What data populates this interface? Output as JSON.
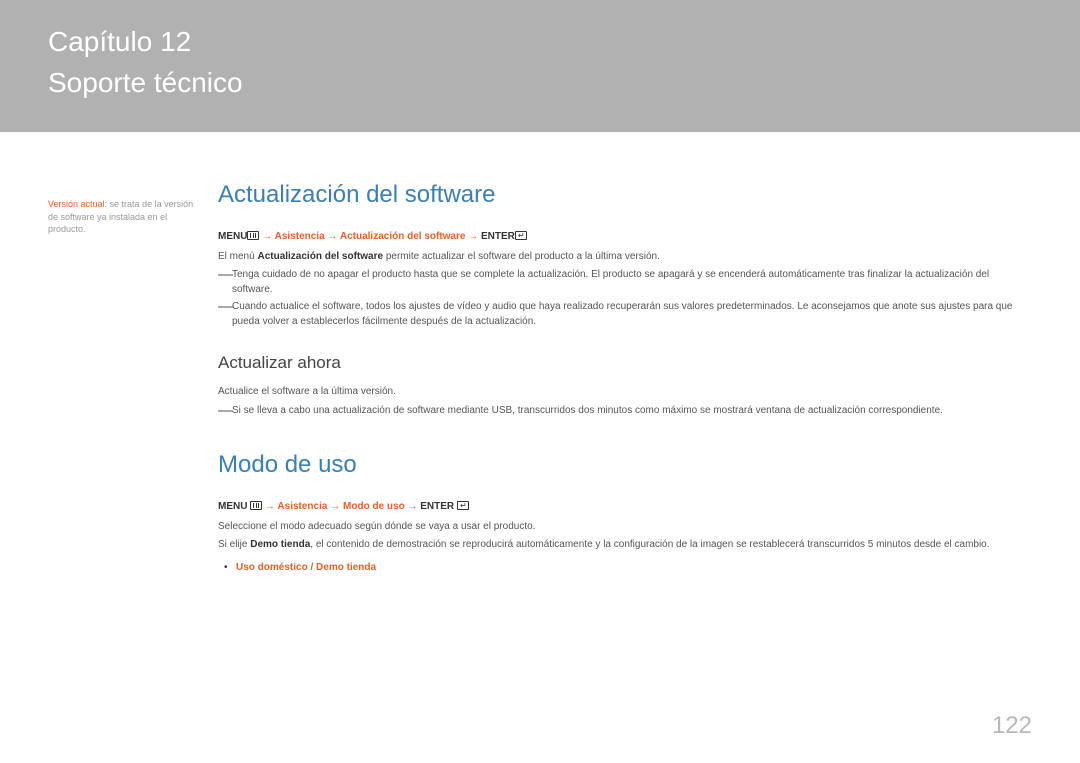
{
  "header": {
    "chapter_number": "Capítulo 12",
    "chapter_title": "Soporte técnico"
  },
  "sidebar": {
    "version_label": "Versión actual",
    "version_desc": ": se trata de la versión de software ya instalada en el producto."
  },
  "section1": {
    "title": "Actualización del software",
    "nav": {
      "menu": "MENU",
      "arrow": " → ",
      "p1": "Asistencia",
      "p2": "Actualización del software",
      "enter": "ENTER"
    },
    "intro_pre": "El menú ",
    "intro_bold": "Actualización del software",
    "intro_post": " permite actualizar el software del producto a la última versión.",
    "dash1": "Tenga cuidado de no apagar el producto hasta que se complete la actualización. El producto se apagará y se encenderá automáticamente tras finalizar la actualización del software.",
    "dash2": "Cuando actualice el software, todos los ajustes de vídeo y audio que haya realizado recuperarán sus valores predeterminados. Le aconsejamos que anote sus ajustes para que pueda volver a establecerlos fácilmente después de la actualización.",
    "sub1": {
      "title": "Actualizar ahora",
      "p1": "Actualice el software a la última versión.",
      "dash1": "Si se lleva a cabo una actualización de software mediante USB, transcurridos dos minutos como máximo se mostrará ventana de actualización correspondiente."
    }
  },
  "section2": {
    "title": "Modo de uso",
    "nav": {
      "menu": "MENU",
      "arrow": " → ",
      "p1": "Asistencia",
      "p2": "Modo de uso",
      "enter": "ENTER"
    },
    "p1": "Seleccione el modo adecuado según dónde se vaya a usar el producto.",
    "p2_pre": "Si elije ",
    "p2_bold": "Demo tienda",
    "p2_post": ", el contenido de demostración se reproducirá automáticamente y la configuración de la imagen se restablecerá transcurridos 5 minutos desde el cambio.",
    "bullet": {
      "opt1": "Uso doméstico",
      "sep": " / ",
      "opt2": "Demo tienda"
    }
  },
  "page_number": "122"
}
